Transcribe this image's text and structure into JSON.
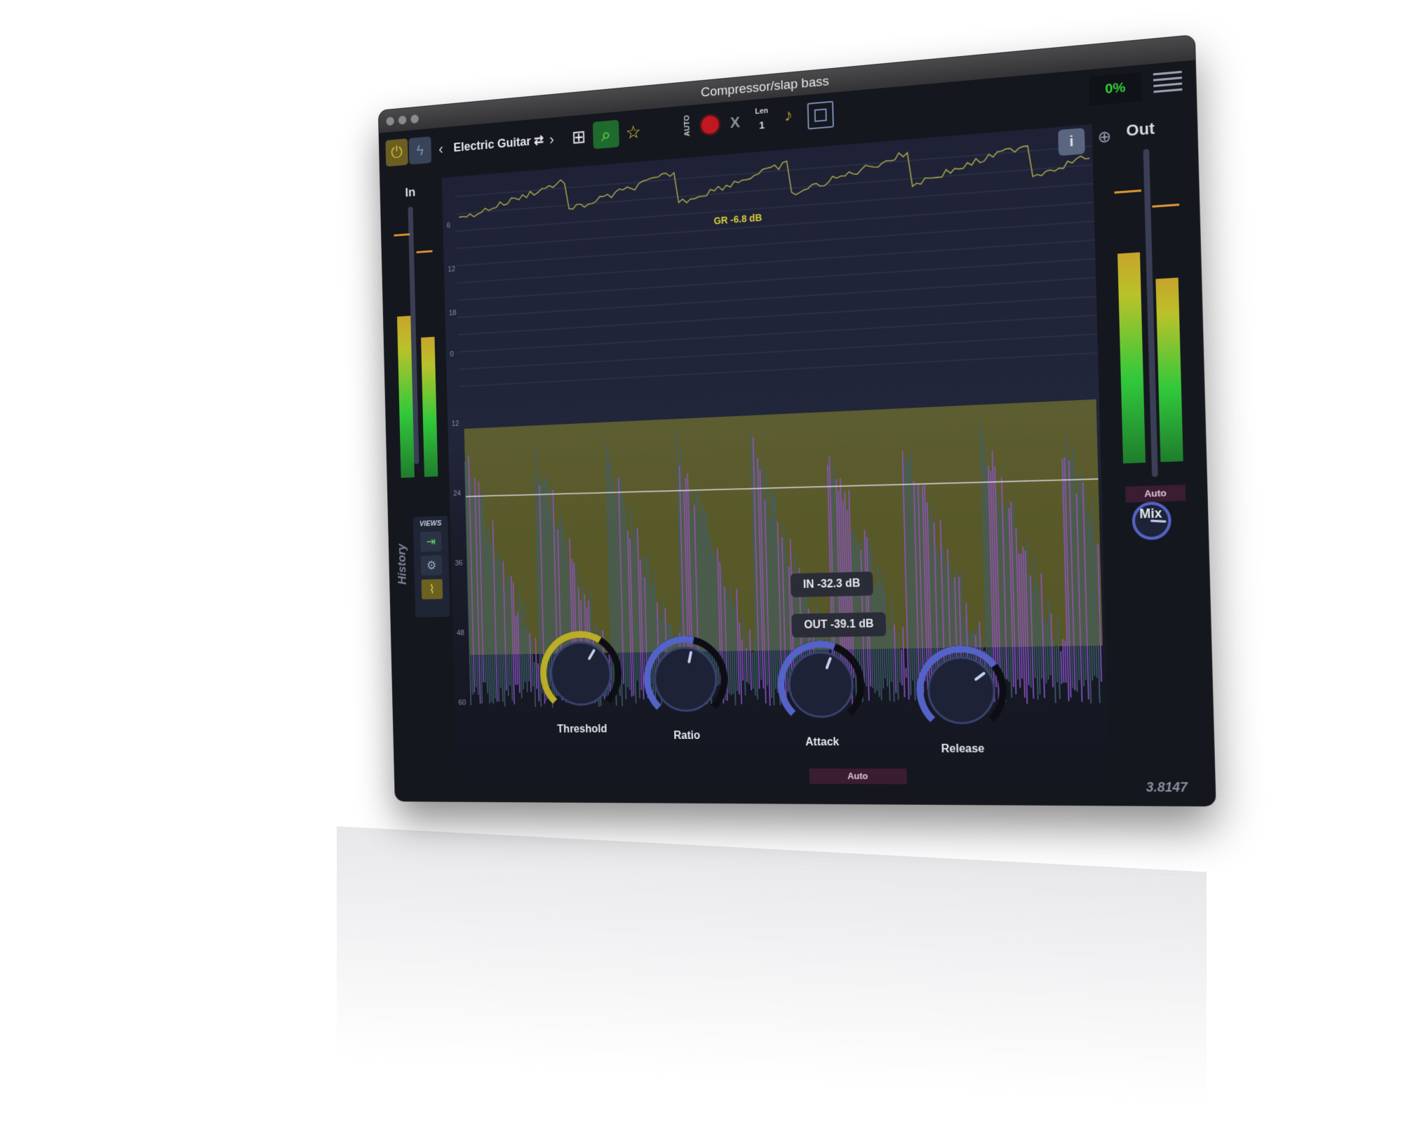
{
  "window": {
    "title": "Compressor/slap bass",
    "cpu_percent": "0%",
    "version": "3.8147"
  },
  "toolbar": {
    "preset_name": "Electric Guitar",
    "auto_label": "AUTO",
    "x_label": "X",
    "len_label": "Len",
    "len_value": "1"
  },
  "meters": {
    "in_label": "In",
    "out_label": "Out",
    "out_auto_label": "Auto",
    "in_levels": [
      0.72,
      0.62
    ],
    "out_levels": [
      0.76,
      0.66
    ]
  },
  "graph": {
    "gr_scale": [
      "6",
      "12",
      "18"
    ],
    "level_scale": [
      "0",
      "12",
      "24",
      "36",
      "48",
      "60"
    ],
    "gr_readout": "GR -6.8 dB",
    "in_readout": "IN -32.3 dB",
    "out_readout": "OUT -39.1 dB"
  },
  "views": {
    "title": "VIEWS",
    "history_label": "History"
  },
  "knobs": [
    {
      "label": "Threshold",
      "value": 0.62,
      "color": "#b9ad2a"
    },
    {
      "label": "Ratio",
      "value": 0.55,
      "color": "#5563c8"
    },
    {
      "label": "Attack",
      "value": 0.58,
      "color": "#5563c8"
    },
    {
      "label": "Release",
      "value": 0.7,
      "color": "#5563c8",
      "auto_label": "Auto"
    }
  ],
  "mix": {
    "label": "Mix",
    "value": 0.85
  },
  "colors": {
    "accent_yellow": "#c8bf2d",
    "accent_green": "#37d23a",
    "knob_blue": "#5563c8",
    "waveform_purple": "#8a55c8"
  }
}
